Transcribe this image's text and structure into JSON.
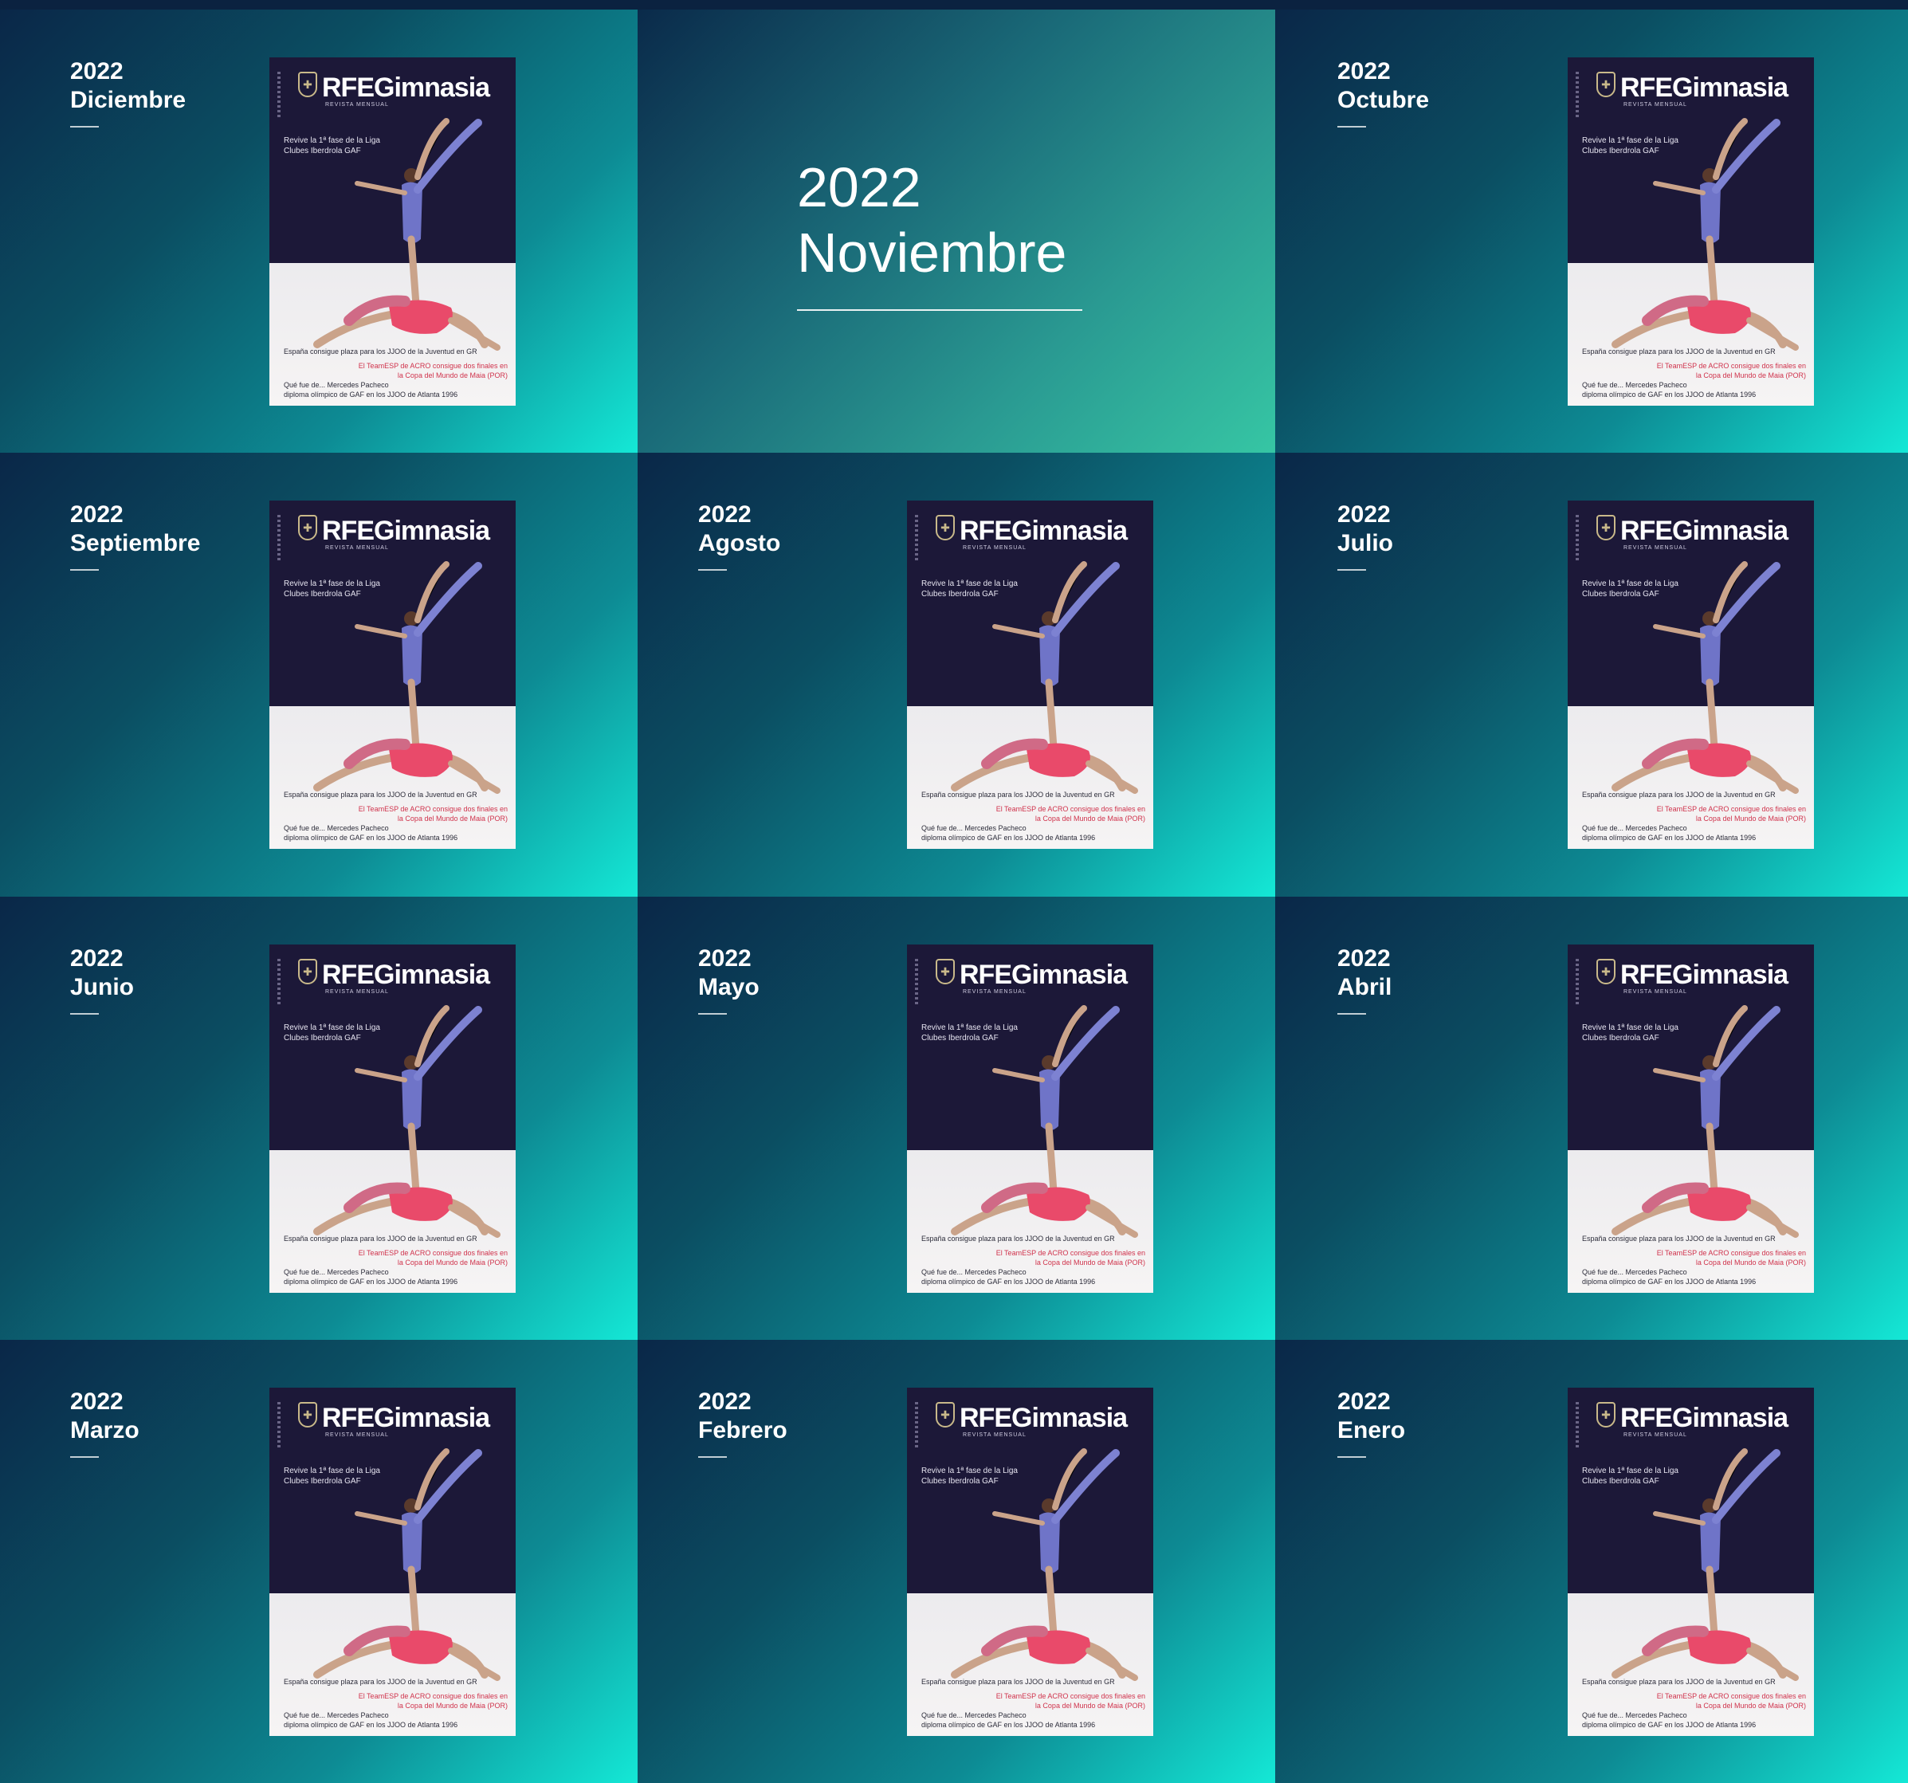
{
  "featured": {
    "year": "2022",
    "month": "Noviembre"
  },
  "cover": {
    "brand": "RFEGimnasia",
    "brand_sub": "REVISTA MENSUAL",
    "headline": "Revive la 1ª fase de la Liga Clubes Iberdrola GAF",
    "line1": "España consigue plaza para los JJOO de la Juventud en GR",
    "line2": "El TeamESP de ACRO consigue dos finales en",
    "line3": "la Copa del Mundo de Maia (POR)",
    "line4": "Qué fue de... Mercedes Pacheco",
    "line5": "diploma olímpico de GAF en los JJOO de Atlanta 1996"
  },
  "issues": [
    {
      "year": "2022",
      "month": "Diciembre"
    },
    {
      "year": "2022",
      "month": "Octubre"
    },
    {
      "year": "2022",
      "month": "Septiembre"
    },
    {
      "year": "2022",
      "month": "Agosto"
    },
    {
      "year": "2022",
      "month": "Julio"
    },
    {
      "year": "2022",
      "month": "Junio"
    },
    {
      "year": "2022",
      "month": "Mayo"
    },
    {
      "year": "2022",
      "month": "Abril"
    },
    {
      "year": "2022",
      "month": "Marzo"
    },
    {
      "year": "2022",
      "month": "Febrero"
    },
    {
      "year": "2022",
      "month": "Enero"
    }
  ]
}
